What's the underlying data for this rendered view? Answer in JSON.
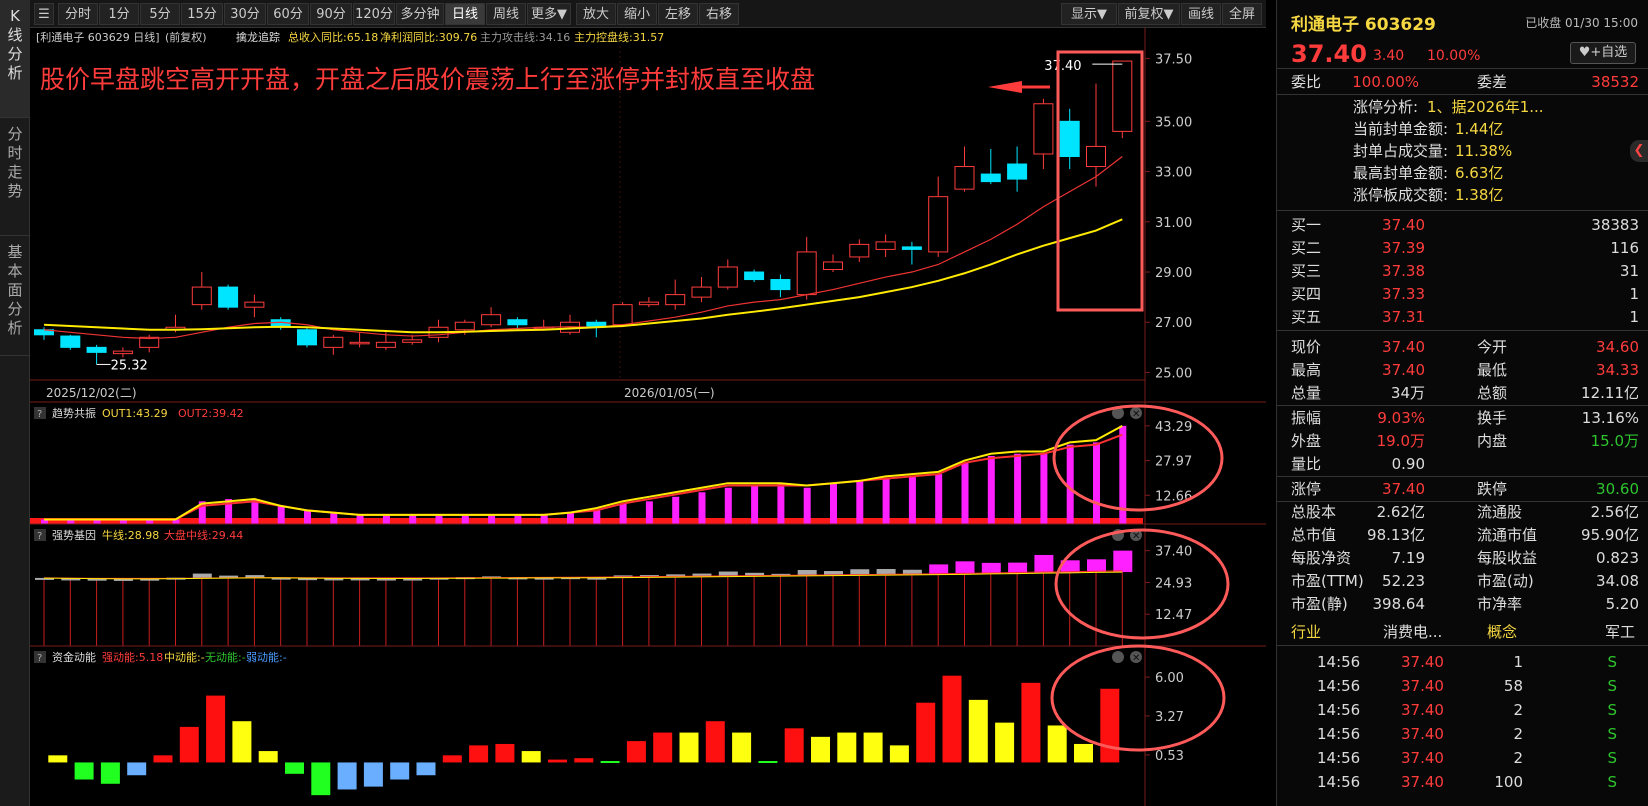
{
  "sidetabs": [
    {
      "label": "K线分析"
    },
    {
      "label": "分时走势"
    },
    {
      "label": "基本面分析"
    }
  ],
  "toolbar": {
    "periods": [
      "分时",
      "1分",
      "5分",
      "15分",
      "30分",
      "60分",
      "90分",
      "120分",
      "多分钟",
      "日线",
      "周线",
      "更多▼"
    ],
    "active": "日线",
    "actions": [
      "放大",
      "缩小",
      "左移",
      "右移"
    ],
    "right": [
      "显示▼",
      "前复权▼",
      "画线",
      "全屏"
    ]
  },
  "header": {
    "stock": "[利通电子 603629 日线]",
    "adjust": "(前复权)",
    "indicator": "擒龙追踪",
    "rev_label": "总收入同比:65.18",
    "profit_label": "净利润同比:309.76",
    "attack_label": "主力攻击线:34.16",
    "control_label": "主力控盘线:31.57"
  },
  "annotation": "股价早盘跳空高开开盘，开盘之后股价震荡上行至涨停并封板直至收盘",
  "price_axis": [
    "37.50",
    "35.00",
    "33.00",
    "31.00",
    "29.00",
    "27.00",
    "25.00"
  ],
  "date_labels": [
    "2025/12/02(二)",
    "2026/01/05(一)"
  ],
  "high_label": "37.40",
  "low_label": "25.32",
  "chart_data": [
    {
      "type": "candlestick",
      "title": "利通电子 603629 日线",
      "ylim": [
        24.7,
        38.0
      ],
      "candles": [
        [
          26.7,
          26.5,
          26.8,
          26.3
        ],
        [
          26.45,
          26.0,
          26.5,
          25.9
        ],
        [
          26.0,
          25.8,
          26.1,
          25.32
        ],
        [
          25.75,
          25.85,
          26.0,
          25.6
        ],
        [
          26.0,
          26.4,
          26.5,
          25.8
        ],
        [
          26.7,
          26.8,
          27.3,
          26.6
        ],
        [
          27.7,
          28.4,
          29.0,
          27.5
        ],
        [
          28.4,
          27.6,
          28.5,
          27.5
        ],
        [
          27.6,
          27.8,
          28.1,
          27.2
        ],
        [
          27.1,
          26.8,
          27.2,
          26.7
        ],
        [
          26.7,
          26.1,
          26.8,
          26.0
        ],
        [
          26.0,
          26.4,
          26.5,
          25.7
        ],
        [
          26.2,
          26.2,
          26.6,
          26.0
        ],
        [
          26.0,
          26.2,
          26.6,
          25.9
        ],
        [
          26.2,
          26.3,
          26.5,
          26.1
        ],
        [
          26.4,
          26.8,
          27.1,
          26.2
        ],
        [
          26.7,
          27.0,
          27.1,
          26.5
        ],
        [
          26.9,
          27.3,
          27.6,
          26.8
        ],
        [
          27.1,
          26.9,
          27.2,
          26.7
        ],
        [
          26.8,
          26.8,
          27.1,
          26.7
        ],
        [
          26.6,
          27.0,
          27.3,
          26.5
        ],
        [
          27.0,
          26.8,
          27.1,
          26.4
        ],
        [
          26.9,
          27.7,
          27.8,
          26.8
        ],
        [
          27.7,
          27.8,
          28.0,
          27.6
        ],
        [
          27.7,
          28.1,
          28.7,
          27.5
        ],
        [
          28.0,
          28.4,
          28.8,
          27.8
        ],
        [
          28.4,
          29.2,
          29.5,
          28.3
        ],
        [
          29.0,
          28.7,
          29.1,
          28.6
        ],
        [
          28.7,
          28.3,
          28.9,
          28.0
        ],
        [
          28.1,
          29.8,
          30.4,
          27.9
        ],
        [
          29.1,
          29.4,
          29.7,
          29.0
        ],
        [
          29.6,
          30.1,
          30.3,
          29.4
        ],
        [
          29.9,
          30.2,
          30.5,
          29.6
        ],
        [
          30.0,
          29.9,
          30.2,
          29.3
        ],
        [
          29.8,
          32.0,
          32.8,
          29.6
        ],
        [
          32.3,
          33.2,
          34.0,
          32.2
        ],
        [
          32.9,
          32.6,
          33.9,
          32.5
        ],
        [
          33.3,
          32.7,
          34.0,
          32.2
        ],
        [
          33.7,
          35.7,
          35.9,
          33.1
        ],
        [
          35.0,
          33.6,
          35.5,
          33.1
        ],
        [
          33.2,
          34.0,
          36.5,
          32.4
        ],
        [
          34.6,
          37.4,
          37.4,
          34.33
        ]
      ],
      "ma_red": [
        26.7,
        26.6,
        26.5,
        26.4,
        26.35,
        26.4,
        26.6,
        26.8,
        26.95,
        27.0,
        26.9,
        26.7,
        26.6,
        26.5,
        26.45,
        26.5,
        26.6,
        26.7,
        26.75,
        26.8,
        26.82,
        26.8,
        26.9,
        27.05,
        27.2,
        27.4,
        27.65,
        27.8,
        27.9,
        28.1,
        28.3,
        28.55,
        28.8,
        29.0,
        29.3,
        29.8,
        30.3,
        30.9,
        31.6,
        32.2,
        32.8,
        33.6
      ],
      "ma_yellow": [
        26.9,
        26.85,
        26.8,
        26.75,
        26.7,
        26.7,
        26.72,
        26.76,
        26.8,
        26.82,
        26.8,
        26.75,
        26.7,
        26.65,
        26.6,
        26.6,
        26.62,
        26.65,
        26.68,
        26.7,
        26.75,
        26.8,
        26.85,
        26.95,
        27.05,
        27.15,
        27.3,
        27.42,
        27.55,
        27.7,
        27.85,
        28.0,
        28.2,
        28.4,
        28.65,
        28.95,
        29.3,
        29.7,
        30.05,
        30.35,
        30.65,
        31.1
      ],
      "xlabels": [
        "2025/12/02(二)",
        "2026/01/05(一)"
      ]
    },
    {
      "type": "bar",
      "title": "趋势共振",
      "label1": "OUT1:43.29",
      "label2": "OUT2:39.42",
      "ylim": [
        0,
        45
      ],
      "ticks": [
        "43.29",
        "27.97",
        "12.66"
      ],
      "bars": [
        2,
        2,
        2,
        2,
        2,
        2,
        10,
        11,
        11,
        8,
        6,
        5,
        4,
        4,
        4,
        4,
        4,
        4,
        4,
        4,
        5,
        6,
        9,
        10,
        12,
        14,
        16,
        17,
        18,
        16,
        18,
        19,
        20,
        21,
        22,
        27,
        30,
        31,
        31,
        35,
        36,
        43.29
      ],
      "out1": [
        2,
        2,
        2,
        2,
        2,
        2,
        9,
        10,
        11,
        8,
        6,
        5,
        4,
        4,
        4,
        4,
        4,
        4,
        4,
        4,
        5,
        7,
        10,
        12,
        14,
        16,
        18,
        18,
        18,
        17,
        18,
        19,
        21,
        22,
        23,
        28,
        31,
        32,
        32,
        36,
        37,
        43.29
      ],
      "out2": [
        2,
        2,
        2,
        2,
        2,
        2,
        8,
        9,
        10,
        8,
        6,
        5,
        4,
        4,
        4,
        4,
        4,
        4,
        4,
        4,
        5,
        6,
        9,
        11,
        13,
        15,
        17,
        17,
        17,
        17,
        18,
        19,
        20,
        21,
        22,
        27,
        29,
        30,
        31,
        34,
        35,
        39.42
      ]
    },
    {
      "type": "bar",
      "title": "强势基因",
      "label1": "牛线:28.98",
      "label2": "大盘中线:29.44",
      "ylim": [
        0,
        40
      ],
      "ticks": [
        "37.40",
        "24.93",
        "12.47"
      ],
      "values": [
        26.7,
        26.5,
        25.8,
        25.85,
        26.4,
        26.8,
        28.4,
        27.6,
        27.8,
        26.8,
        26.1,
        26.4,
        26.2,
        26.2,
        26.3,
        26.8,
        27.0,
        27.3,
        26.9,
        26.8,
        27.0,
        26.8,
        27.7,
        27.8,
        28.1,
        28.4,
        29.2,
        28.7,
        28.3,
        29.8,
        29.4,
        30.1,
        30.2,
        29.9,
        32.0,
        33.2,
        32.6,
        32.7,
        35.7,
        33.6,
        34.0,
        37.4
      ],
      "bull": [
        26.6,
        26.5,
        26.4,
        26.3,
        26.3,
        26.4,
        26.5,
        26.6,
        26.7,
        26.7,
        26.6,
        26.5,
        26.5,
        26.45,
        26.45,
        26.5,
        26.55,
        26.6,
        26.65,
        26.7,
        26.7,
        26.75,
        26.8,
        26.9,
        27.0,
        27.1,
        27.2,
        27.3,
        27.4,
        27.5,
        27.6,
        27.7,
        27.8,
        27.9,
        28.0,
        28.1,
        28.3,
        28.4,
        28.6,
        28.7,
        28.85,
        28.98
      ],
      "market": [
        26.7,
        26.6,
        26.5,
        26.5,
        26.5,
        26.5,
        26.6,
        26.7,
        26.8,
        26.8,
        26.75,
        26.7,
        26.7,
        26.7,
        26.7,
        26.7,
        26.75,
        26.8,
        26.85,
        26.9,
        26.95,
        27.0,
        27.1,
        27.2,
        27.3,
        27.4,
        27.5,
        27.6,
        27.7,
        27.8,
        27.9,
        28.0,
        28.1,
        28.2,
        28.35,
        28.5,
        28.65,
        28.8,
        29.0,
        29.1,
        29.3,
        29.44
      ]
    },
    {
      "type": "bar",
      "title": "资金动能",
      "label1": "强动能:5.18",
      "label2": "中动能:-",
      "label3": "无动能:-",
      "label4": "弱动能:-",
      "ylim": [
        -2.5,
        6.5
      ],
      "ticks": [
        "6.00",
        "3.27",
        "0.53"
      ],
      "values": [
        0.5,
        -1.2,
        -1.5,
        -0.9,
        0.5,
        2.5,
        4.7,
        2.9,
        0.8,
        -0.8,
        -2.3,
        -1.9,
        -1.7,
        -1.2,
        -0.9,
        0.5,
        1.2,
        1.3,
        0.8,
        0.2,
        0.3,
        0.1,
        1.5,
        2.1,
        2.1,
        2.9,
        2.1,
        0.1,
        2.4,
        1.8,
        2.1,
        2.1,
        1.2,
        4.2,
        6.1,
        4.4,
        2.8,
        5.6,
        2.6,
        1.3,
        5.18
      ],
      "kinds": [
        "y",
        "g",
        "g",
        "b",
        "r",
        "r",
        "r",
        "y",
        "y",
        "g",
        "g",
        "b",
        "b",
        "b",
        "b",
        "r",
        "r",
        "r",
        "y",
        "r",
        "r",
        "g",
        "r",
        "r",
        "y",
        "r",
        "y",
        "g",
        "r",
        "y",
        "y",
        "y",
        "y",
        "r",
        "r",
        "y",
        "y",
        "r",
        "y",
        "y",
        "r"
      ]
    }
  ],
  "panel": {
    "title": "利通电子 603629",
    "status": "已收盘 01/30 15:00",
    "price": "37.40",
    "change": "3.40",
    "pct": "10.00%",
    "fav": "♥+自选",
    "webi_label": "委比",
    "webi": "100.00%",
    "weicha_label": "委差",
    "weicha": "38532",
    "limit_lines": [
      {
        "k": "涨停分析:",
        "v": "1、据2026年1..."
      },
      {
        "k": "当前封单金额:",
        "v": "1.44亿"
      },
      {
        "k": "封单占成交量:",
        "v": "11.38%"
      },
      {
        "k": "最高封单金额:",
        "v": "6.63亿"
      },
      {
        "k": "涨停板成交额:",
        "v": "1.38亿"
      }
    ],
    "bids": [
      {
        "k": "买一",
        "p": "37.40",
        "v": "38383"
      },
      {
        "k": "买二",
        "p": "37.39",
        "v": "116"
      },
      {
        "k": "买三",
        "p": "37.38",
        "v": "31"
      },
      {
        "k": "买四",
        "p": "37.33",
        "v": "1"
      },
      {
        "k": "买五",
        "p": "37.31",
        "v": "1"
      }
    ],
    "stats": [
      {
        "k1": "现价",
        "v1": "37.40",
        "c1": "red",
        "k2": "今开",
        "v2": "34.60",
        "c2": "red"
      },
      {
        "k1": "最高",
        "v1": "37.40",
        "c1": "red",
        "k2": "最低",
        "v2": "34.33",
        "c2": "red"
      },
      {
        "k1": "总量",
        "v1": "34万",
        "c1": "white",
        "k2": "总额",
        "v2": "12.11亿",
        "c2": "white"
      },
      {
        "k1": "振幅",
        "v1": "9.03%",
        "c1": "red",
        "k2": "换手",
        "v2": "13.16%",
        "c2": "white"
      },
      {
        "k1": "外盘",
        "v1": "19.0万",
        "c1": "red",
        "k2": "内盘",
        "v2": "15.0万",
        "c2": "green"
      },
      {
        "k1": "量比",
        "v1": "0.90",
        "c1": "white",
        "k2": "",
        "v2": "",
        "c2": "white"
      },
      {
        "k1": "涨停",
        "v1": "37.40",
        "c1": "red",
        "k2": "跌停",
        "v2": "30.60",
        "c2": "green"
      },
      {
        "k1": "总股本",
        "v1": "2.62亿",
        "c1": "white",
        "k2": "流通股",
        "v2": "2.56亿",
        "c2": "white"
      },
      {
        "k1": "总市值",
        "v1": "98.13亿",
        "c1": "white",
        "k2": "流通市值",
        "v2": "95.90亿",
        "c2": "white"
      },
      {
        "k1": "每股净资",
        "v1": "7.19",
        "c1": "white",
        "k2": "每股收益",
        "v2": "0.823",
        "c2": "white"
      },
      {
        "k1": "市盈(TTM)",
        "v1": "52.23",
        "c1": "white",
        "k2": "市盈(动)",
        "v2": "34.08",
        "c2": "white"
      },
      {
        "k1": "市盈(静)",
        "v1": "398.64",
        "c1": "white",
        "k2": "市净率",
        "v2": "5.20",
        "c2": "white"
      }
    ],
    "industry_label": "行业",
    "industry": "消费电...",
    "concept_label": "概念",
    "concept": "军工",
    "ticks": [
      {
        "t": "14:56",
        "p": "37.40",
        "v": "1",
        "s": "S"
      },
      {
        "t": "14:56",
        "p": "37.40",
        "v": "58",
        "s": "S"
      },
      {
        "t": "14:56",
        "p": "37.40",
        "v": "2",
        "s": "S"
      },
      {
        "t": "14:56",
        "p": "37.40",
        "v": "2",
        "s": "S"
      },
      {
        "t": "14:56",
        "p": "37.40",
        "v": "2",
        "s": "S"
      },
      {
        "t": "14:56",
        "p": "37.40",
        "v": "100",
        "s": "S"
      }
    ]
  }
}
